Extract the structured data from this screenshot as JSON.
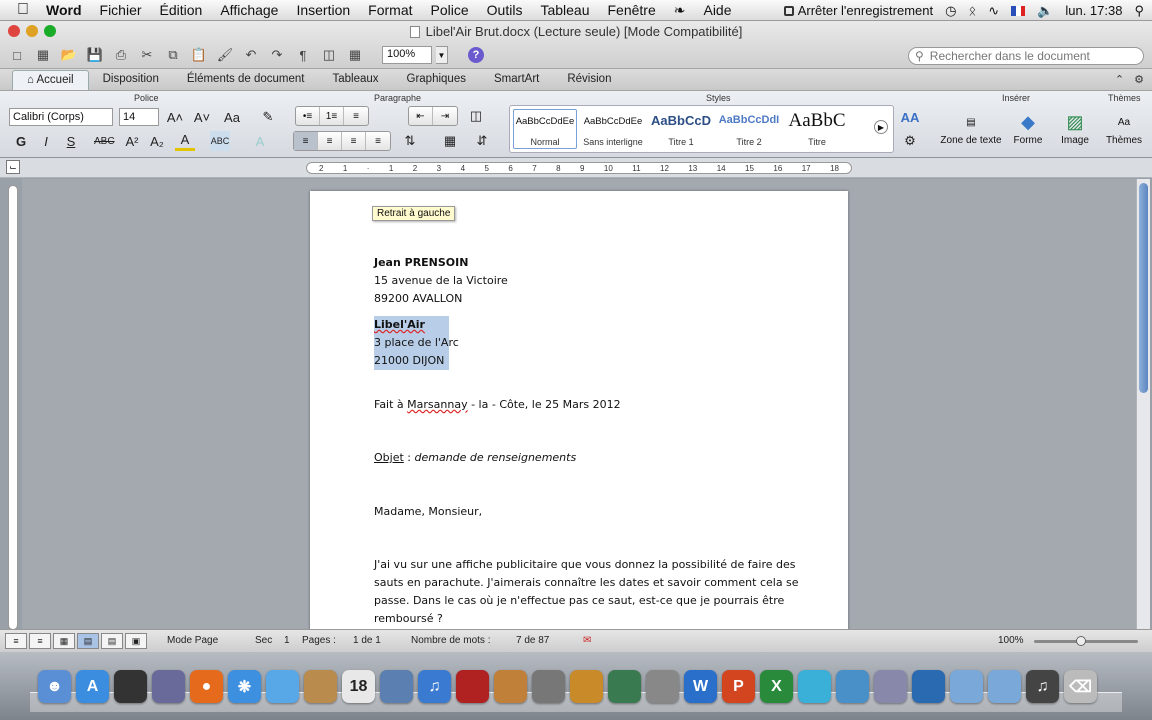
{
  "menubar": {
    "app": "Word",
    "items": [
      "Fichier",
      "Édition",
      "Affichage",
      "Insertion",
      "Format",
      "Police",
      "Outils",
      "Tableau",
      "Fenêtre",
      "Aide"
    ],
    "recording": "Arrêter l'enregistrement",
    "clock": "lun. 17:38"
  },
  "window": {
    "title": "Libel'Air Brut.docx (Lecture seule) [Mode Compatibilité]",
    "zoom": "100%",
    "search_placeholder": "Rechercher dans le document"
  },
  "ribbon_tabs": [
    "Accueil",
    "Disposition",
    "Éléments de document",
    "Tableaux",
    "Graphiques",
    "SmartArt",
    "Révision"
  ],
  "ribbon": {
    "group_police": "Police",
    "group_paragraphe": "Paragraphe",
    "group_styles": "Styles",
    "group_inserer": "Insérer",
    "group_themes": "Thèmes",
    "font_name": "Calibri (Corps)",
    "font_size": "14",
    "styles": [
      {
        "preview": "AaBbCcDdEe",
        "name": "Normal"
      },
      {
        "preview": "AaBbCcDdEe",
        "name": "Sans interligne"
      },
      {
        "preview": "AaBbCcD",
        "name": "Titre 1"
      },
      {
        "preview": "AaBbCcDdI",
        "name": "Titre 2"
      },
      {
        "preview": "AaBbC",
        "name": "Titre"
      }
    ],
    "insert_items": [
      "Zone de texte",
      "Forme",
      "Image"
    ],
    "themes_label": "Thèmes"
  },
  "ruler": {
    "ticks": [
      "2",
      "1",
      "",
      "1",
      "2",
      "3",
      "4",
      "5",
      "6",
      "7",
      "8",
      "9",
      "10",
      "11",
      "12",
      "13",
      "14",
      "15",
      "16",
      "17",
      "18"
    ],
    "tooltip": "Retrait à gauche"
  },
  "document": {
    "sender_name": "Jean PRENSOIN",
    "sender_street": "15 avenue de la Victoire",
    "sender_city": "89200 AVALLON",
    "recipient_name": "Libel'Air",
    "recipient_street": "3 place de l'Arc",
    "recipient_city": "21000 DIJON",
    "place_prefix": "Fait à ",
    "place_word": "Marsannay",
    "place_suffix": " - la - Côte, le 25 Mars 2012",
    "object_label": "Objet",
    "object_sep": " : ",
    "object_text": "demande de renseignements",
    "salutation": "Madame, Monsieur,",
    "body": [
      "J'ai vu sur une affiche publicitaire que vous donnez la possibilité de faire des",
      "sauts en parachute. J'aimerais connaître les dates et savoir comment cela se",
      "passe. Dans le cas où je n'effectue pas ce saut, est-ce que je pourrais être",
      "remboursé ?"
    ]
  },
  "statusbar": {
    "mode": "Mode Page",
    "sec_label": "Sec",
    "sec_value": "1",
    "pages_label": "Pages :",
    "pages_value": "1 de 1",
    "words_label": "Nombre de mots :",
    "words_value": "7 de 87",
    "zoom": "100%"
  },
  "dock_icons": [
    "finder-icon",
    "app-store-icon",
    "dashboard-icon",
    "preview-icon",
    "firefox-icon",
    "safari-icon",
    "ichat-icon",
    "address-book-icon",
    "ical-icon",
    "iphoto-icon",
    "itunes-icon",
    "photo-booth-icon",
    "iphoto-library-icon",
    "imovie-icon",
    "garageband-icon",
    "time-machine-icon",
    "system-preferences-icon",
    "word-icon",
    "powerpoint-icon",
    "excel-icon",
    "messenger-icon",
    "network-icon",
    "preview2-icon",
    "quicktime-icon",
    "applications-folder-icon",
    "documents-folder-icon",
    "music-icon",
    "trash-icon"
  ]
}
